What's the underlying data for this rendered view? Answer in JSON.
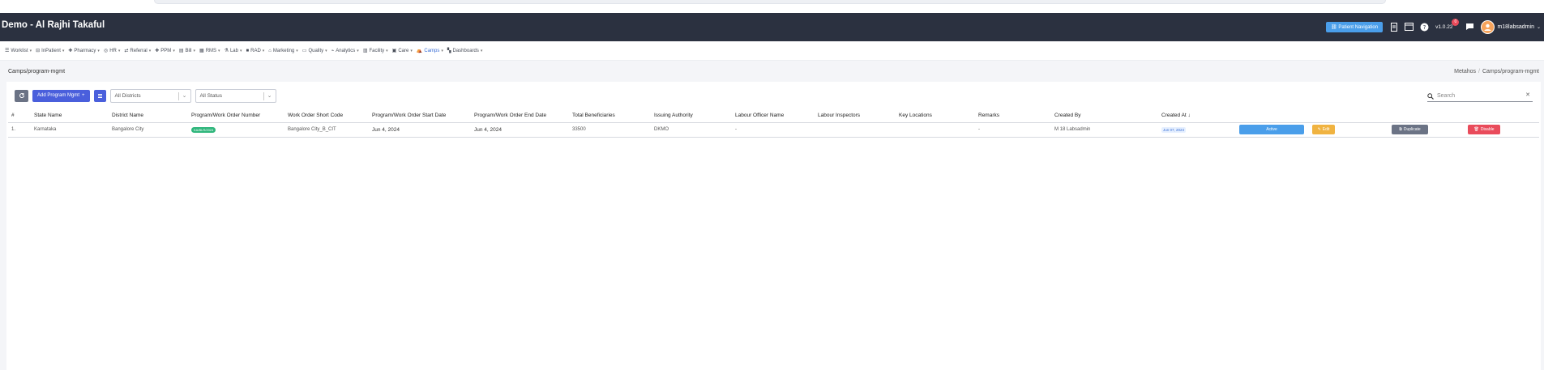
{
  "app": {
    "title": "Demo - Al Rajhi Takaful"
  },
  "header": {
    "patient_nav_label": "Patient Navigation",
    "version": "v1.0.22",
    "notif_count": "0",
    "username": "m18labsadmin"
  },
  "menu": [
    {
      "label": "Worklist",
      "icon": "list-icon"
    },
    {
      "label": "InPatient",
      "icon": "bed-icon"
    },
    {
      "label": "Pharmacy",
      "icon": "plus-icon"
    },
    {
      "label": "HR",
      "icon": "people-icon"
    },
    {
      "label": "Referral",
      "icon": "referral-icon"
    },
    {
      "label": "PPM",
      "icon": "plus-icon"
    },
    {
      "label": "Bill",
      "icon": "bill-icon"
    },
    {
      "label": "RMS",
      "icon": "rms-icon"
    },
    {
      "label": "Lab",
      "icon": "flask-icon"
    },
    {
      "label": "RAD",
      "icon": "rad-icon"
    },
    {
      "label": "Marketing",
      "icon": "marketing-icon"
    },
    {
      "label": "Quality",
      "icon": "quality-icon"
    },
    {
      "label": "Analytics",
      "icon": "analytics-icon"
    },
    {
      "label": "Facility",
      "icon": "facility-icon"
    },
    {
      "label": "Care",
      "icon": "care-icon"
    },
    {
      "label": "Camps",
      "icon": "camps-icon",
      "active": true
    },
    {
      "label": "Dashboards",
      "icon": "dashboard-icon"
    }
  ],
  "page": {
    "title": "Camps/program-mgmt",
    "breadcrumb": [
      "Metahos",
      "Camps/program-mgmt"
    ]
  },
  "toolbar": {
    "add_label": "Add Program Mgmt",
    "districts_placeholder": "All Districts",
    "status_placeholder": "All Status",
    "search_placeholder": "Search"
  },
  "table": {
    "columns": [
      "#",
      "State Name",
      "District Name",
      "Program/Work Order Number",
      "Work Order Short Code",
      "Program/Work Order Start Date",
      "Program/Work Order End Date",
      "Total Beneficiaries",
      "Issuing Authority",
      "Labour Officer Name",
      "Labour Inspectors",
      "Key Locations",
      "Remarks",
      "Created By",
      "Created At"
    ],
    "rows": [
      {
        "num": "1.",
        "state": "Karnataka",
        "district": "Bangalore City",
        "program_number": "KA/BLR/2024",
        "short_code": "Bangalore City_B_CIT",
        "start_date": "Jun 4, 2024",
        "end_date": "Jun 4, 2024",
        "beneficiaries": "33500",
        "authority": "DKMO",
        "labour_officer": "-",
        "labour_inspectors": "",
        "key_locations": "",
        "remarks": "-",
        "created_by": "M 18 Labsadmin",
        "created_at": "Jun 07, 2024",
        "actions": {
          "active": "Active",
          "edit": "Edit",
          "duplicate": "Duplicate",
          "disable": "Disable"
        }
      }
    ]
  },
  "colors": {
    "navbar": "#2b3140",
    "primary": "#4a5fdc",
    "info": "#4a9eea",
    "warning": "#f0b341",
    "danger": "#e94b5b",
    "success": "#2fb67c"
  }
}
